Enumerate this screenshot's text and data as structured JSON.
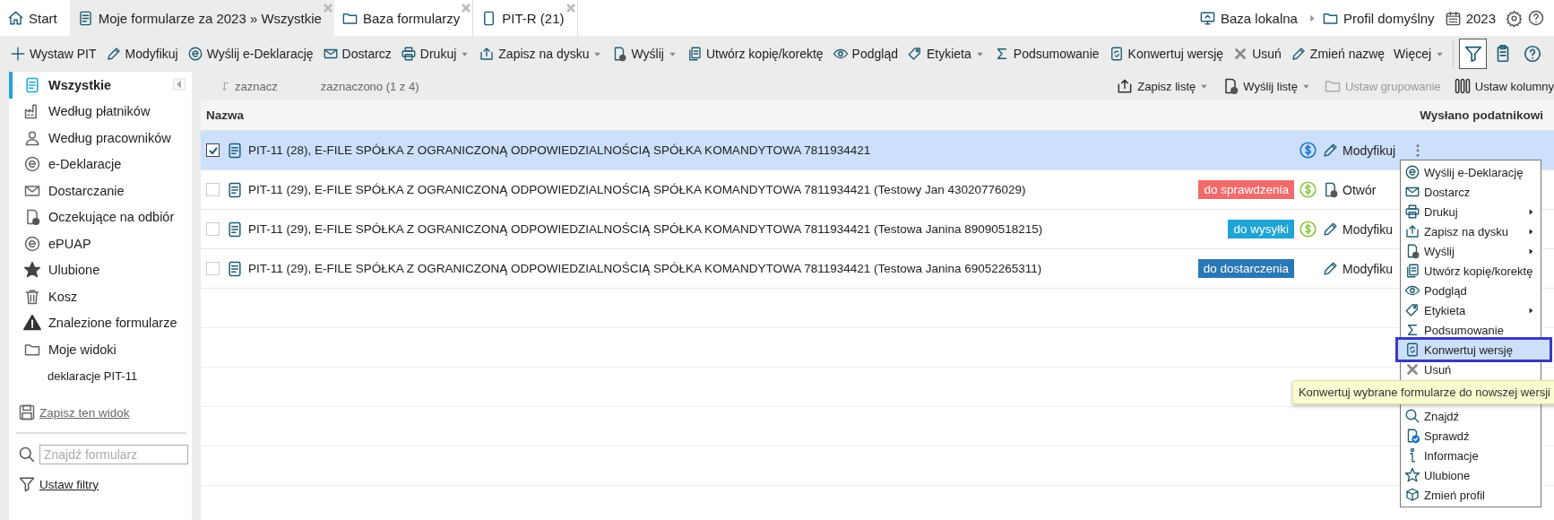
{
  "tabs": [
    {
      "label": "Start",
      "selected": false,
      "closable": false
    },
    {
      "label": "Moje formularze za 2023 » Wszystkie",
      "selected": true,
      "closable": true
    },
    {
      "label": "Baza formularzy",
      "selected": false,
      "closable": true
    },
    {
      "label": "PIT-R (21)",
      "selected": false,
      "closable": true
    }
  ],
  "header_right": {
    "database": "Baza lokalna",
    "profile": "Profil domyślny",
    "year": "2023"
  },
  "toolbar": [
    {
      "label": "Wystaw PIT",
      "dropdown": false
    },
    {
      "label": "Modyfikuj",
      "dropdown": false
    },
    {
      "label": "Wyślij e-Deklarację",
      "dropdown": false
    },
    {
      "label": "Dostarcz",
      "dropdown": false
    },
    {
      "label": "Drukuj",
      "dropdown": true
    },
    {
      "label": "Zapisz na dysku",
      "dropdown": true
    },
    {
      "label": "Wyślij",
      "dropdown": true
    },
    {
      "label": "Utwórz kopię/korektę",
      "dropdown": false
    },
    {
      "label": "Podgląd",
      "dropdown": false
    },
    {
      "label": "Etykieta",
      "dropdown": true
    },
    {
      "label": "Podsumowanie",
      "dropdown": false
    },
    {
      "label": "Konwertuj wersję",
      "dropdown": false
    },
    {
      "label": "Usuń",
      "dropdown": false
    },
    {
      "label": "Zmień nazwę",
      "dropdown": false
    },
    {
      "label": "Więcej",
      "dropdown": true
    }
  ],
  "filter_selected": true,
  "sidebar": {
    "items": [
      {
        "label": "Wszystkie",
        "selected": true
      },
      {
        "label": "Według płatników",
        "selected": false
      },
      {
        "label": "Według pracowników",
        "selected": false
      },
      {
        "label": "e-Deklaracje",
        "selected": false
      },
      {
        "label": "Dostarczanie",
        "selected": false
      },
      {
        "label": "Oczekujące na odbiór",
        "selected": false
      },
      {
        "label": "ePUAP",
        "selected": false
      },
      {
        "label": "Ulubione",
        "selected": false
      },
      {
        "label": "Kosz",
        "selected": false
      },
      {
        "label": "Znalezione formularze",
        "selected": false
      },
      {
        "label": "Moje widoki",
        "selected": false,
        "children": [
          {
            "label": "deklaracje PIT-11",
            "selected": false
          }
        ]
      }
    ],
    "save_view": "Zapisz ten widok",
    "search": {
      "placeholder": "Znajdź formularz"
    },
    "filters": "Ustaw filtry"
  },
  "list_toolbar": {
    "select": "zaznacz",
    "selected_count": "zaznaczono (1 z 4)",
    "actions": [
      {
        "label": "Zapisz listę",
        "dropdown": true,
        "disabled": false
      },
      {
        "label": "Wyślij listę",
        "dropdown": true,
        "disabled": false
      },
      {
        "label": "Ustaw grupowanie",
        "dropdown": false,
        "disabled": true
      },
      {
        "label": "Ustaw kolumny",
        "dropdown": false,
        "disabled": false
      }
    ]
  },
  "table": {
    "columns": [
      "Nazwa",
      "Wysłano podatnikowi"
    ],
    "rows": [
      {
        "name": "PIT-11 (28), E-FILE SPÓŁKA Z OGRANICZONĄ ODPOWIEDZIALNOŚCIĄ SPÓŁKA KOMANDYTOWA 7811934421",
        "checked": true,
        "selected": true,
        "payment": {
          "color": "#1a73c9"
        },
        "action": {
          "kind": "edit",
          "label": "Modyfikuj"
        }
      },
      {
        "name": "PIT-11 (29), E-FILE SPÓŁKA Z OGRANICZONĄ ODPOWIEDZIALNOŚCIĄ SPÓŁKA KOMANDYTOWA 7811934421 (Testowy Jan 43020776029)",
        "checked": false,
        "selected": false,
        "badge": {
          "text": "do sprawdzenia",
          "color": "#f26b6b"
        },
        "payment": {
          "color": "#8cc63f"
        },
        "action": {
          "kind": "open",
          "label": "Otwór"
        }
      },
      {
        "name": "PIT-11 (29), E-FILE SPÓŁKA Z OGRANICZONĄ ODPOWIEDZIALNOŚCIĄ SPÓŁKA KOMANDYTOWA 7811934421 (Testowa Janina 89090518215)",
        "checked": false,
        "selected": false,
        "badge": {
          "text": "do wysyłki",
          "color": "#1ea5d6"
        },
        "payment": {
          "color": "#8cc63f"
        },
        "action": {
          "kind": "edit",
          "label": "Modyfiku"
        }
      },
      {
        "name": "PIT-11 (29), E-FILE SPÓŁKA Z OGRANICZONĄ ODPOWIEDZIALNOŚCIĄ SPÓŁKA KOMANDYTOWA 7811934421 (Testowa Janina 69052265311)",
        "checked": false,
        "selected": false,
        "badge": {
          "text": "do dostarczenia",
          "color": "#2a78b5"
        },
        "action": {
          "kind": "edit",
          "label": "Modyfiku"
        }
      }
    ]
  },
  "context_menu": {
    "items": [
      {
        "label": "Wyślij e-Deklarację",
        "submenu": false,
        "highlighted": false
      },
      {
        "label": "Dostarcz",
        "submenu": false,
        "highlighted": false
      },
      {
        "label": "Drukuj",
        "submenu": true,
        "highlighted": false
      },
      {
        "label": "Zapisz na dysku",
        "submenu": true,
        "highlighted": false
      },
      {
        "label": "Wyślij",
        "submenu": true,
        "highlighted": false
      },
      {
        "label": "Utwórz kopię/korektę",
        "submenu": false,
        "highlighted": false
      },
      {
        "label": "Podgląd",
        "submenu": false,
        "highlighted": false
      },
      {
        "label": "Etykieta",
        "submenu": true,
        "highlighted": false
      },
      {
        "label": "Podsumowanie",
        "submenu": false,
        "highlighted": false
      },
      {
        "label": "Konwertuj wersję",
        "submenu": false,
        "highlighted": true
      },
      {
        "label": "Usuń",
        "submenu": false,
        "highlighted": false
      },
      {
        "label": "Znajdź",
        "submenu": false,
        "highlighted": false
      },
      {
        "label": "Sprawdź",
        "submenu": false,
        "highlighted": false
      },
      {
        "label": "Informacje",
        "submenu": false,
        "highlighted": false
      },
      {
        "label": "Ulubione",
        "submenu": false,
        "highlighted": false
      },
      {
        "label": "Zmień profil",
        "submenu": false,
        "highlighted": false
      }
    ]
  },
  "tooltip": "Konwertuj wybrane formularze do nowszej wersji"
}
